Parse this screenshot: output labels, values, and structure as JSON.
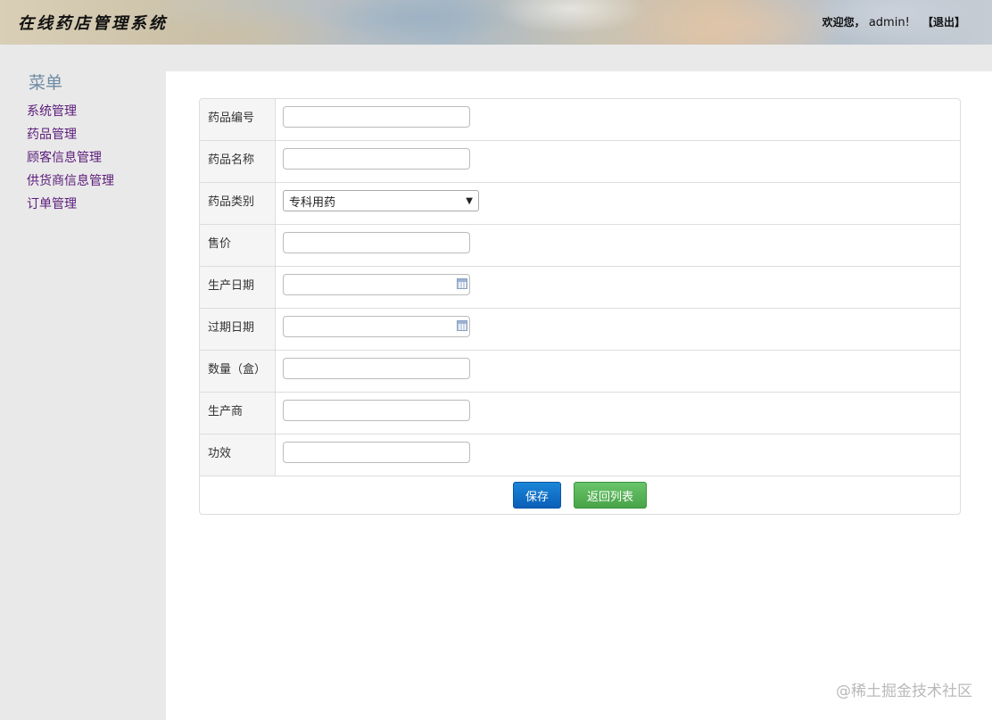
{
  "header": {
    "app_title": "在线药店管理系统",
    "welcome": "欢迎您，",
    "user": "admin!",
    "logout": "【退出】"
  },
  "sidebar": {
    "title": "菜单",
    "items": [
      {
        "label": "系统管理"
      },
      {
        "label": "药品管理"
      },
      {
        "label": "顾客信息管理"
      },
      {
        "label": "供货商信息管理"
      },
      {
        "label": "订单管理"
      }
    ]
  },
  "form": {
    "fields": {
      "drug_code": {
        "label": "药品编号",
        "value": ""
      },
      "drug_name": {
        "label": "药品名称",
        "value": ""
      },
      "drug_category": {
        "label": "药品类别",
        "value": "专科用药"
      },
      "price": {
        "label": "售价",
        "value": ""
      },
      "production_date": {
        "label": "生产日期",
        "value": ""
      },
      "expiry_date": {
        "label": "过期日期",
        "value": ""
      },
      "quantity": {
        "label": "数量（盒）",
        "value": ""
      },
      "manufacturer": {
        "label": "生产商",
        "value": ""
      },
      "efficacy": {
        "label": "功效",
        "value": ""
      }
    },
    "save_label": "保存",
    "back_label": "返回列表"
  },
  "watermark": "@稀土掘金技术社区",
  "colors": {
    "save_button": "#0a6cc9",
    "back_button": "#5cb85c",
    "menu_link": "#5a1a7a",
    "menu_title": "#6f8aa3"
  }
}
